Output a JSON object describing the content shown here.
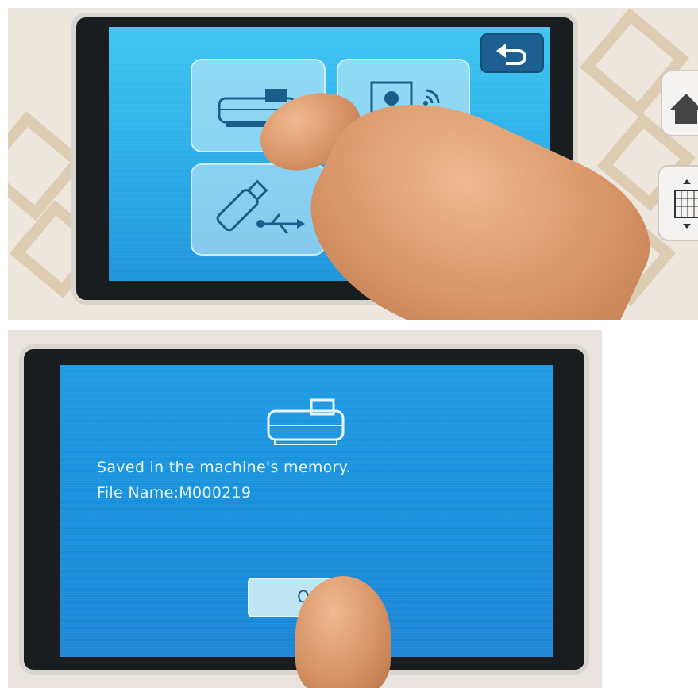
{
  "top_panel": {
    "tiles": [
      {
        "icon": "cutting-machine-icon"
      },
      {
        "icon": "laptop-wireless-icon"
      },
      {
        "icon": "usb-flash-drive-icon"
      }
    ],
    "back_button_icon": "return-arrow-icon",
    "side_buttons": [
      "home-icon",
      "pattern-grid-icon"
    ]
  },
  "bottom_panel": {
    "icon": "cutting-machine-icon",
    "message_line1": "Saved in the machine's memory.",
    "message_line2": "File Name:M000219",
    "ok_button_label": "OK",
    "ok_button_visible": "O"
  },
  "colors": {
    "screen_top": "#2db1ea",
    "screen_bottom": "#1890dc",
    "tile": "#cfeaf6",
    "back_button": "#1c5f90",
    "text": "#e7f4fb"
  }
}
